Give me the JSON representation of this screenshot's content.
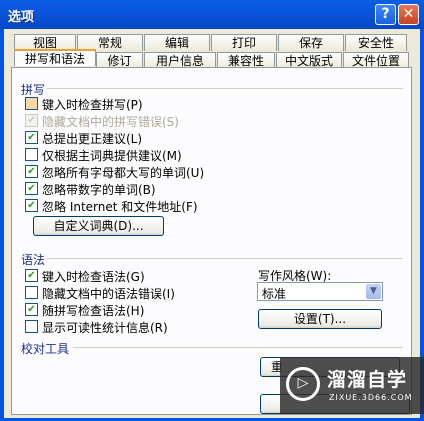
{
  "window": {
    "title": "选项",
    "help_label": "?",
    "close_label": "✕"
  },
  "tabs_row1": [
    "视图",
    "常规",
    "编辑",
    "打印",
    "保存",
    "安全性"
  ],
  "tabs_row2": [
    "拼写和语法",
    "修订",
    "用户信息",
    "兼容性",
    "中文版式",
    "文件位置"
  ],
  "active_tab": "拼写和语法",
  "spelling": {
    "title": "拼写",
    "options": [
      {
        "label": "键入时检查拼写(P)",
        "checked": false,
        "disabled": false
      },
      {
        "label": "隐藏文档中的拼写错误(S)",
        "checked": true,
        "disabled": true
      },
      {
        "label": "总提出更正建议(L)",
        "checked": true,
        "disabled": false
      },
      {
        "label": "仅根据主词典提供建议(M)",
        "checked": false,
        "disabled": false
      },
      {
        "label": "忽略所有字母都大写的单词(U)",
        "checked": true,
        "disabled": false
      },
      {
        "label": "忽略带数字的单词(B)",
        "checked": true,
        "disabled": false
      },
      {
        "label": "忽略 Internet 和文件地址(F)",
        "checked": true,
        "disabled": false
      }
    ],
    "custom_dict_button": "自定义词典(D)..."
  },
  "grammar": {
    "title": "语法",
    "options": [
      {
        "label": "键入时检查语法(G)",
        "checked": true
      },
      {
        "label": "隐藏文档中的语法错误(I)",
        "checked": false
      },
      {
        "label": "随拼写检查语法(H)",
        "checked": true
      },
      {
        "label": "显示可读性统计信息(R)",
        "checked": false
      }
    ],
    "style_label": "写作风格(W):",
    "style_value": "标准",
    "settings_button": "设置(T)..."
  },
  "proofing": {
    "title": "校对工具",
    "recheck_button_partial": "重"
  },
  "watermark": {
    "name": "溜溜自学",
    "url": "ZIXUE.3D66.COM",
    "logo_glyph": "▷"
  }
}
